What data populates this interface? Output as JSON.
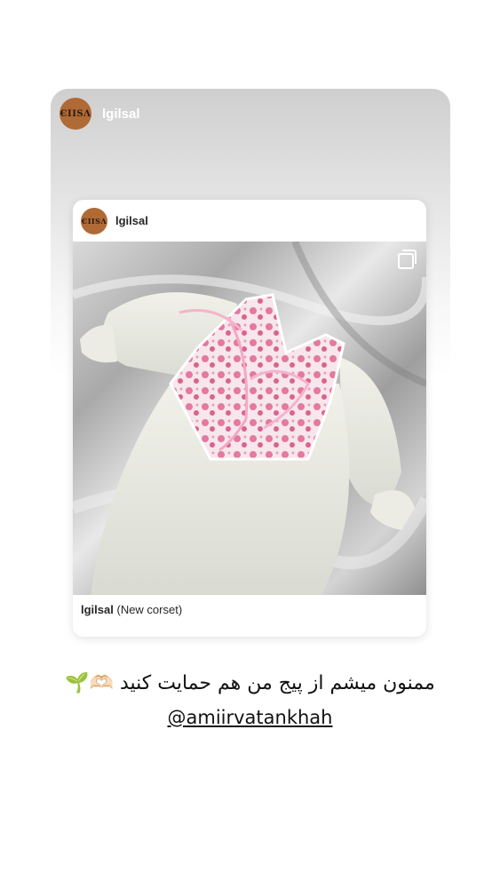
{
  "story": {
    "username": "lgilsal",
    "avatar_text": "ЄIISΛ"
  },
  "post": {
    "username": "lgilsal",
    "avatar_text": "ЄIISΛ",
    "caption_user": "lgilsal",
    "caption_text": "(New corset)"
  },
  "text_overlay": "ممنون میشم از پیج من هم حمایت کنید 🫶🏻🌱",
  "mention": "@amiirvatankhah",
  "colors": {
    "avatar_bg": "#b06a35",
    "card_gradient_top": "#cfcfcf",
    "text": "#111111"
  },
  "icons": {
    "multi_post": "carousel-icon"
  }
}
